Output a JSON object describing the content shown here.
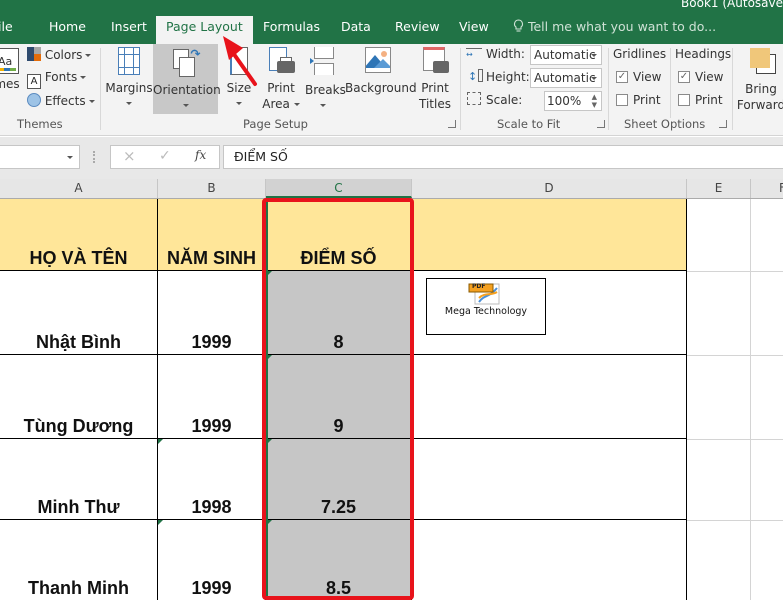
{
  "window": {
    "title": "Book1 (Autosave"
  },
  "tabs": [
    {
      "label": "ile",
      "active": false
    },
    {
      "label": "Home",
      "active": false
    },
    {
      "label": "Insert",
      "active": false
    },
    {
      "label": "Page Layout",
      "active": true
    },
    {
      "label": "Formulas",
      "active": false
    },
    {
      "label": "Data",
      "active": false
    },
    {
      "label": "Review",
      "active": false
    },
    {
      "label": "View",
      "active": false
    }
  ],
  "tell_me": {
    "placeholder": "Tell me what you want to do...",
    "icon": "lightbulb-icon"
  },
  "ribbon": {
    "themes": {
      "themes_label": "mes",
      "colors_label": "Colors",
      "fonts_label": "Fonts",
      "effects_label": "Effects",
      "group_label": "Themes"
    },
    "page_setup": {
      "margins_label": "Margins",
      "orientation_label": "Orientation",
      "size_label": "Size",
      "print_area_label_1": "Print",
      "print_area_label_2": "Area",
      "breaks_label": "Breaks",
      "background_label": "Background",
      "print_titles_label_1": "Print",
      "print_titles_label_2": "Titles",
      "group_label": "Page Setup"
    },
    "scale_to_fit": {
      "width_label": "Width:",
      "width_value": "Automatic",
      "height_label": "Height:",
      "height_value": "Automatic",
      "scale_label": "Scale:",
      "scale_value": "100%",
      "group_label": "Scale to Fit"
    },
    "sheet_options": {
      "gridlines_label": "Gridlines",
      "headings_label": "Headings",
      "view_label": "View",
      "print_label": "Print",
      "gridlines_view": true,
      "gridlines_print": false,
      "headings_view": true,
      "headings_print": false,
      "group_label": "Sheet Options"
    },
    "arrange": {
      "bring_forward_label_1": "Bring",
      "bring_forward_label_2": "Forward"
    }
  },
  "formula_bar": {
    "name_box": "",
    "cancel_icon": "×",
    "enter_icon": "✓",
    "fx_label": "fx",
    "value": "ĐIỂM SỐ"
  },
  "columns": [
    "A",
    "B",
    "C",
    "D",
    "E",
    "F"
  ],
  "selected_column": "C",
  "table": {
    "headers": [
      "HỌ VÀ TÊN",
      "NĂM SINH",
      "ĐIỂM SỐ"
    ],
    "rows": [
      [
        "Nhật Bình",
        "1999",
        "8"
      ],
      [
        "Tùng Dương",
        "1999",
        "9"
      ],
      [
        "Minh Thư",
        "1998",
        "7.25"
      ],
      [
        "Thanh Minh",
        "1999",
        "8.5"
      ]
    ]
  },
  "embedded_object": {
    "label": "Mega Technology",
    "icon": "pdf-file-icon",
    "badge": "PDF"
  },
  "annotation": {
    "arrow_color": "#e8131b",
    "highlight_color": "#e8131b"
  },
  "colors": {
    "brand": "#217346",
    "header_fill": "#ffe699",
    "selected_fill": "#c6c6c6"
  }
}
